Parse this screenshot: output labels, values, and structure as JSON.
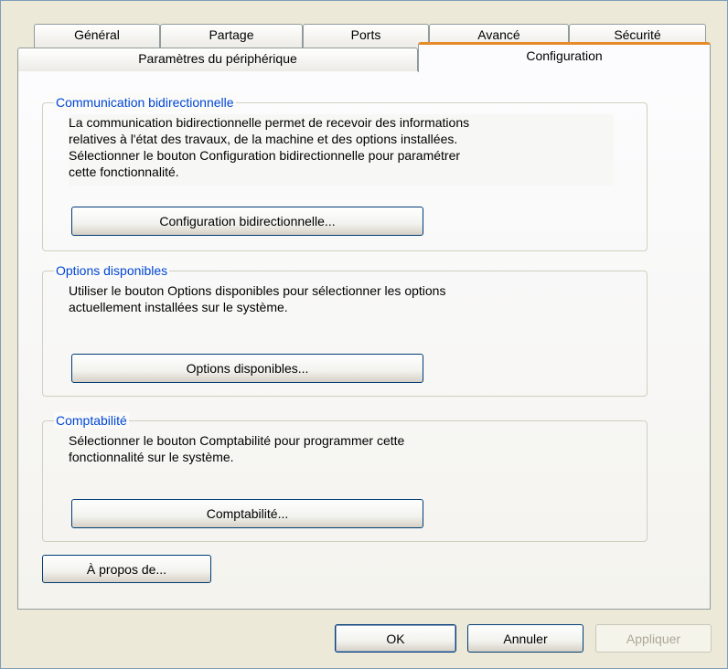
{
  "tabs": {
    "row_back": [
      "Général",
      "Partage",
      "Ports",
      "Avancé",
      "Sécurité"
    ],
    "row_front": [
      "Paramètres du périphérique",
      "Configuration"
    ],
    "active": "Configuration"
  },
  "groups": {
    "bidirectional": {
      "legend": "Communication bidirectionnelle",
      "lines": [
        "La communication bidirectionnelle permet de recevoir des informations",
        "relatives à l'état des travaux, de la machine et des options installées.",
        "Sélectionner le bouton Configuration bidirectionnelle pour paramétrer",
        "cette fonctionnalité."
      ],
      "button": "Configuration bidirectionnelle..."
    },
    "options": {
      "legend": "Options disponibles",
      "lines": [
        "Utiliser le bouton Options disponibles pour sélectionner les options",
        "actuellement installées sur le système."
      ],
      "button": "Options disponibles..."
    },
    "accounting": {
      "legend": "Comptabilité",
      "lines": [
        "Sélectionner le bouton Comptabilité pour programmer cette",
        "fonctionnalité sur le système."
      ],
      "button": "Comptabilité..."
    }
  },
  "about_button": "À propos de...",
  "footer": {
    "ok": "OK",
    "cancel": "Annuler",
    "apply": "Appliquer"
  },
  "colors": {
    "accent_tab": "#e68b2c",
    "legend": "#0046d5",
    "button_border": "#003c74"
  }
}
